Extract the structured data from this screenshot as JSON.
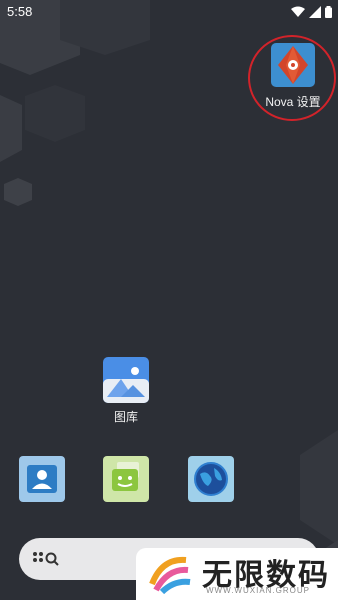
{
  "status_bar": {
    "time": "5:58",
    "icons": [
      "wifi-icon",
      "signal-icon",
      "battery-icon"
    ]
  },
  "apps": {
    "nova_settings": {
      "label": "Nova 设置",
      "icon": "nova-settings-icon",
      "highlighted": true
    },
    "gallery": {
      "label": "图库",
      "icon": "gallery-icon"
    }
  },
  "dock": {
    "items": [
      "contacts-icon",
      "messages-icon",
      "browser-icon"
    ]
  },
  "search_bar": {
    "icon": "search-icon"
  },
  "watermark": {
    "title": "无限数码",
    "subtitle": "WWW.WUXIAN.GROUP"
  },
  "colors": {
    "background": "#2c2f36",
    "highlight_ring": "#d2232a",
    "nova_blue": "#3d8fd0",
    "nova_red": "#d2452b"
  }
}
